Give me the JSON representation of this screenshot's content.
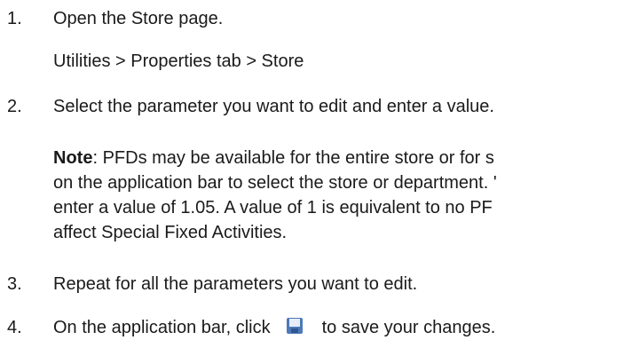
{
  "steps": [
    {
      "num": "1.",
      "text": "Open the Store page."
    },
    {
      "num": "2.",
      "text": "Select the parameter you want to edit and enter a value."
    },
    {
      "num": "3.",
      "text": "Repeat for all the parameters you want to edit."
    },
    {
      "num": "4.",
      "text_before": "On the application bar, click",
      "text_after": "to save your changes."
    }
  ],
  "path": "Utilities > Properties tab > Store",
  "note": {
    "label": "Note",
    "lines": [
      ": PFDs may be available for the entire store or for s",
      "on the application bar to select the store or department. '",
      "enter a value of 1.05. A value of 1 is equivalent to no PF",
      "affect Special Fixed Activities."
    ]
  },
  "icons": {
    "save": "save-icon"
  },
  "colors": {
    "text": "#1a1a1a",
    "save_icon": "#4d79b8"
  }
}
